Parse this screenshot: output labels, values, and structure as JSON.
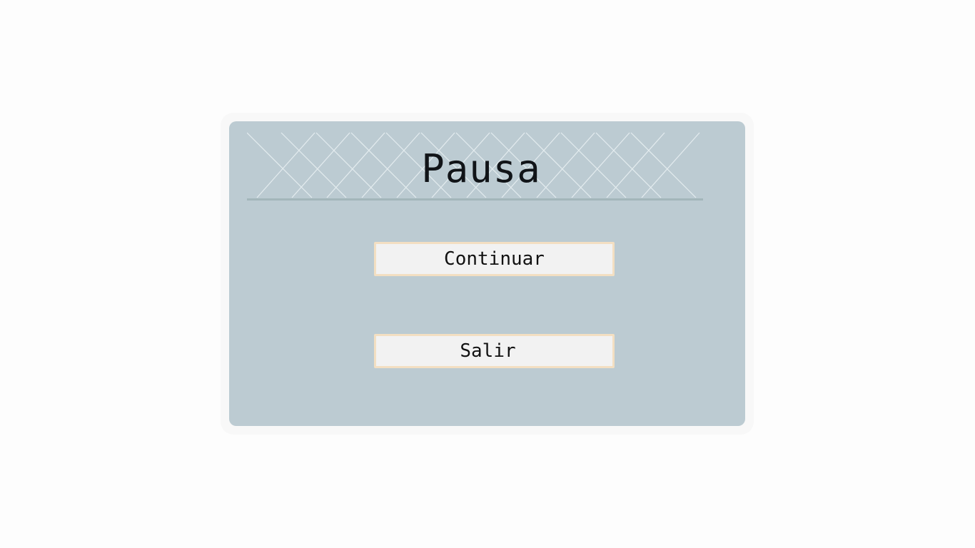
{
  "pause_menu": {
    "title": "Pausa",
    "buttons": {
      "continue_label": "Continuar",
      "exit_label": "Salir"
    }
  },
  "colors": {
    "page_background": "#fdfdfd",
    "panel_background": "#bccbd2",
    "button_background": "#f2f2f2",
    "button_border": "#f3dfc2",
    "divider": "#a3b6ba",
    "title_text": "#111418"
  }
}
